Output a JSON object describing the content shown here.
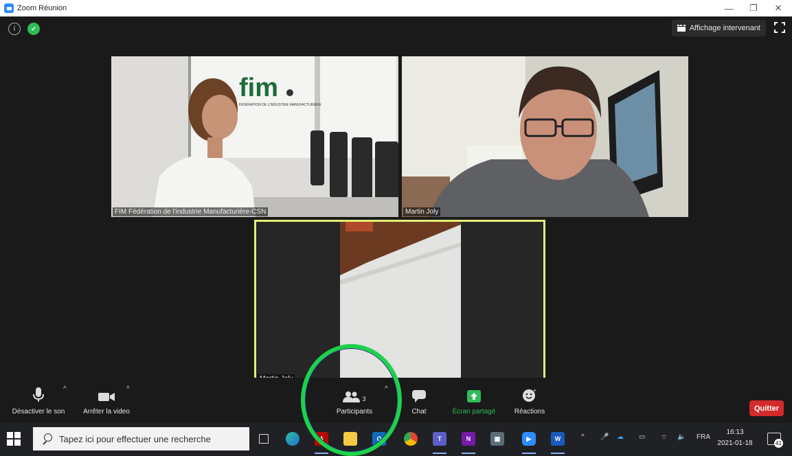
{
  "window": {
    "title": "Zoom Réunion",
    "controls": {
      "minimize": "—",
      "maximize": "❐",
      "close": "✕"
    }
  },
  "meeting": {
    "view_button_label": "Affichage intervenant",
    "tiles": [
      {
        "name": "FIM Fédération de l'industrie Manufacturière-CSN",
        "screen_logo": "fim",
        "screen_subtext": "FÉDÉRATION DE L'INDUSTRIE MANUFACTURIÈRE"
      },
      {
        "name": "Martin Joly"
      },
      {
        "name": "Martin Joly",
        "active_speaker": true
      }
    ]
  },
  "toolbar": {
    "mute_label": "Désactiver le son",
    "video_label": "Arrêter la video",
    "participants_label": "Participants",
    "participants_count": "3",
    "chat_label": "Chat",
    "share_label": "Écran partagé",
    "reactions_label": "Réactions",
    "quit_label": "Quitter"
  },
  "taskbar": {
    "search_placeholder": "Tapez ici pour effectuer une recherche",
    "apps": [
      "task-view",
      "edge",
      "acrobat",
      "file-explorer",
      "outlook",
      "chrome",
      "teams",
      "onenote",
      "calculator",
      "zoom",
      "word"
    ],
    "tray": {
      "language": "FRA"
    },
    "clock": {
      "time": "16:13",
      "date": "2021-01-18"
    },
    "notifications_count": "41"
  },
  "colors": {
    "accent_green": "#2ebd59",
    "quit_red": "#d32a2a",
    "active_speaker_border": "#e4ef75",
    "highlight_circle": "#1dd24a"
  }
}
